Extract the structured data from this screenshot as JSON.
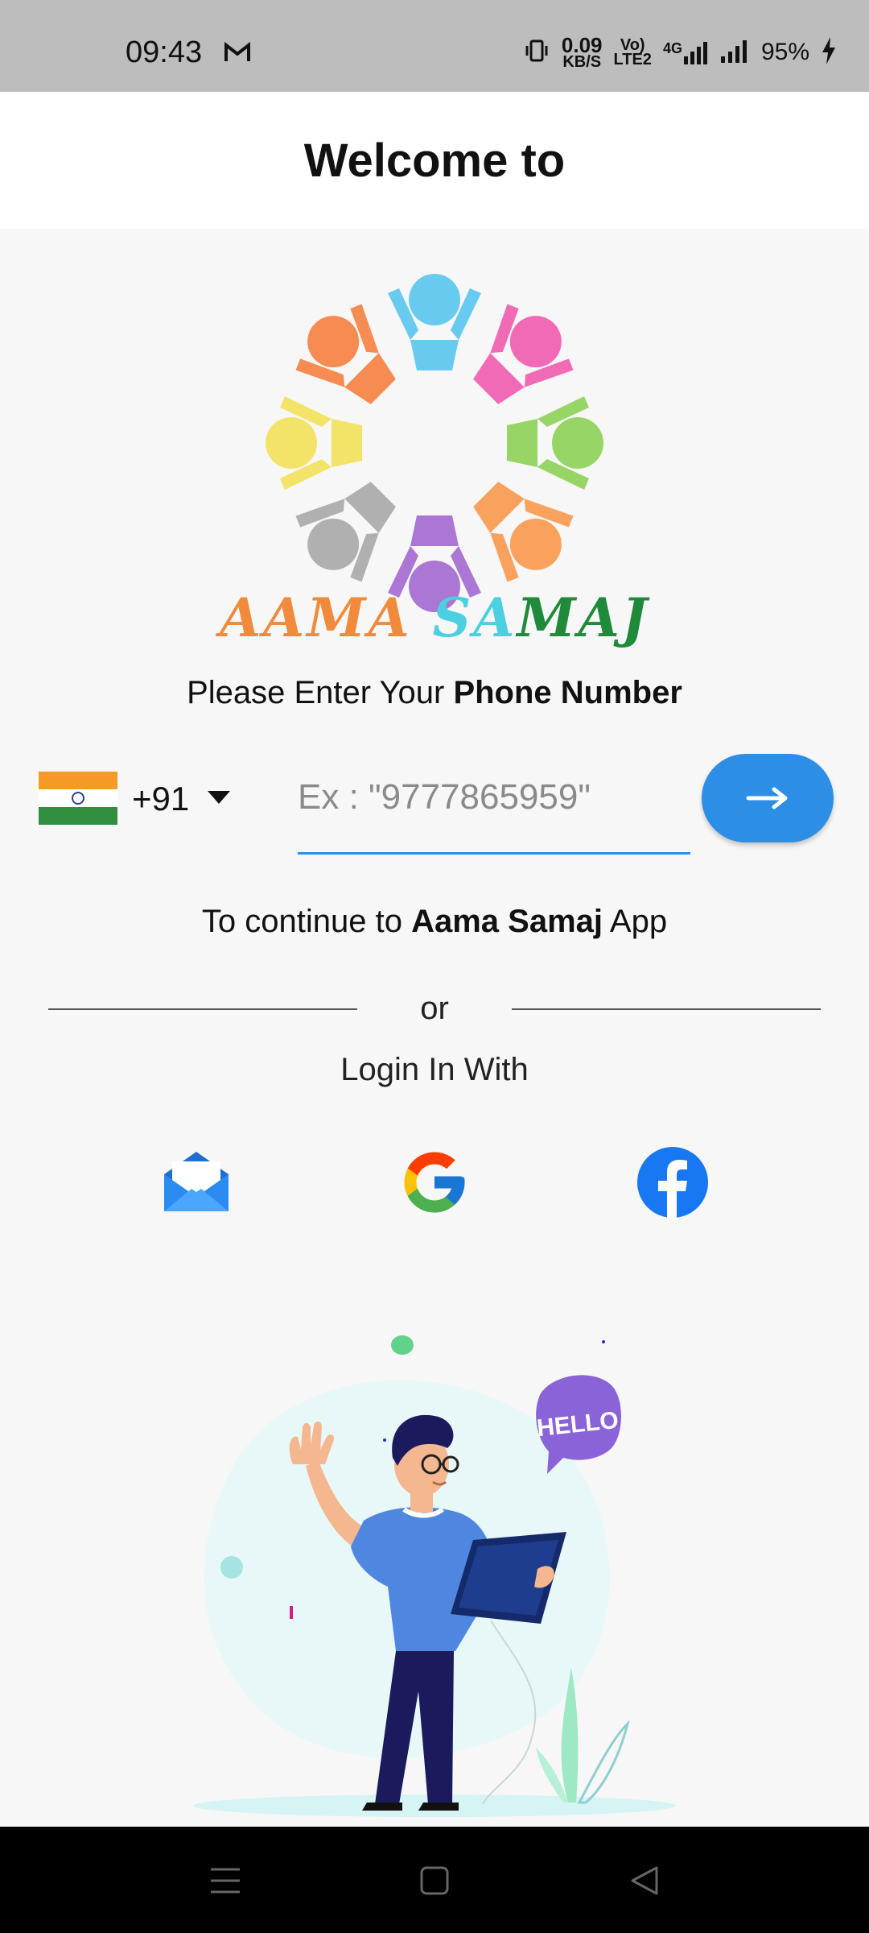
{
  "status_bar": {
    "time": "09:43",
    "net_speed_value": "0.09",
    "net_speed_unit": "KB/S",
    "volte_top": "Vo)",
    "volte_bottom": "LTE2",
    "network_type": "4G",
    "battery": "95%",
    "icons": [
      "gmail-icon",
      "vibrate-icon",
      "signal-icon",
      "charging-icon"
    ]
  },
  "header": {
    "title": "Welcome to"
  },
  "brand": {
    "part1": "AAMA ",
    "part2": "SA",
    "part3": "MAJ"
  },
  "prompt": {
    "prefix": "Please Enter Your ",
    "bold": "Phone Number"
  },
  "phone": {
    "country_flag": "india-flag-icon",
    "dial_code": "+91",
    "placeholder": "Ex : \"9777865959\"",
    "value": ""
  },
  "continue": {
    "prefix": "To continue to ",
    "bold": "Aama Samaj",
    "suffix": " App"
  },
  "divider_text": "or",
  "login_with": "Login In With",
  "social": [
    "email-icon",
    "google-icon",
    "facebook-icon"
  ],
  "illustration": {
    "bubble_text": "HELLO"
  },
  "colors": {
    "accent": "#2d8ee6",
    "status_bar": "#bdbdbd",
    "background": "#f7f7f7",
    "brand_orange": "#f28a3c",
    "brand_cyan": "#4ccfe0",
    "brand_green": "#1e8a3a"
  }
}
